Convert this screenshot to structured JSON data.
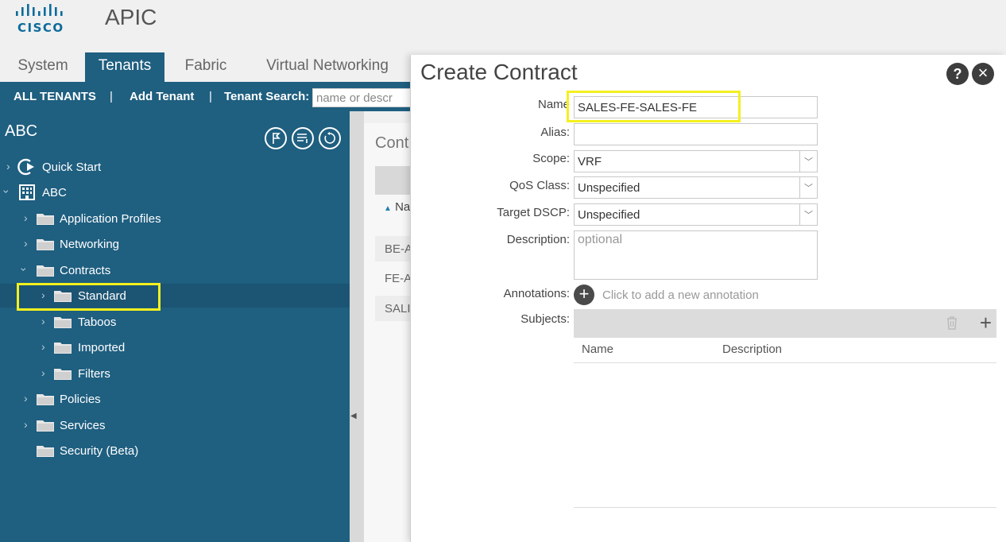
{
  "header": {
    "brand": "CISCO",
    "app_title": "APIC"
  },
  "tabs": [
    "System",
    "Tenants",
    "Fabric",
    "Virtual Networking"
  ],
  "active_tab": "Tenants",
  "subnav": {
    "all_tenants": "ALL TENANTS",
    "separator": "|",
    "add_tenant": "Add Tenant",
    "tenant_search_label": "Tenant Search:",
    "search_placeholder": "name or descr"
  },
  "sidebar": {
    "title": "ABC",
    "tree": [
      {
        "label": "Quick Start"
      },
      {
        "label": "ABC"
      },
      {
        "label": "Application Profiles"
      },
      {
        "label": "Networking"
      },
      {
        "label": "Contracts"
      },
      {
        "label": "Standard"
      },
      {
        "label": "Taboos"
      },
      {
        "label": "Imported"
      },
      {
        "label": "Filters"
      },
      {
        "label": "Policies"
      },
      {
        "label": "Services"
      },
      {
        "label": "Security (Beta)"
      }
    ]
  },
  "background_panel": {
    "title": "Cont",
    "sort_header": "Na",
    "rows": [
      "BE-A",
      "FE-A",
      "SALI"
    ]
  },
  "modal": {
    "title": "Create Contract",
    "help": "?",
    "close": "×",
    "fields": {
      "name_label": "Name",
      "name_value": "SALES-FE-SALES-FE",
      "alias_label": "Alias:",
      "alias_value": "",
      "scope_label": "Scope:",
      "scope_value": "VRF",
      "qos_label": "QoS Class:",
      "qos_value": "Unspecified",
      "dscp_label": "Target DSCP:",
      "dscp_value": "Unspecified",
      "description_label": "Description:",
      "description_placeholder": "optional",
      "annotations_label": "Annotations:",
      "annotations_hint": "Click to add a new annotation",
      "subjects_label": "Subjects:"
    },
    "subjects_table": {
      "columns": [
        "Name",
        "Description"
      ]
    }
  },
  "colors": {
    "brand_blue": "#1f5f80",
    "highlight": "#f4f01f"
  }
}
